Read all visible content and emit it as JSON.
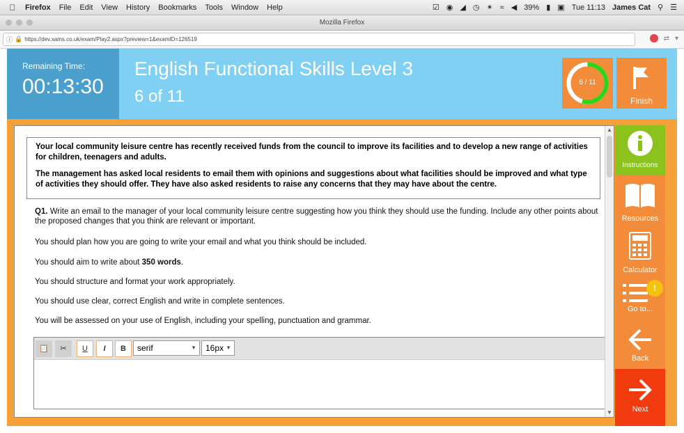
{
  "menubar": {
    "items": [
      "Firefox",
      "File",
      "Edit",
      "View",
      "History",
      "Bookmarks",
      "Tools",
      "Window",
      "Help"
    ],
    "battery": "39%",
    "clock": "Tue 11:13",
    "user": "James Cat"
  },
  "window": {
    "title": "Mozilla Firefox"
  },
  "browser": {
    "url": "https://dev.xams.co.uk/exam/Play2.aspx?preview=1&examID=126519"
  },
  "exam": {
    "remaining_label": "Remaining Time:",
    "remaining_time": "00:13:30",
    "title": "English Functional Skills Level 3",
    "position": "6 of 11",
    "progress_label": "6 / 11",
    "progress_fraction": 0.545,
    "finish_label": "Finish"
  },
  "notice": {
    "para1": "Your local community leisure centre has recently received funds from the council to improve its facilities and to develop a new range of activities for children, teenagers and adults.",
    "para2": "The management has asked local residents to email them with opinions and suggestions about what facilities should be improved and what type of activities they should offer. They have also asked residents to raise any concerns that they may have about the centre."
  },
  "question": {
    "q_label": "Q1.",
    "q_text": " Write an email to the manager of your local community leisure centre suggesting how you think they should use the funding. Include any other points about the proposed changes that you think are relevant or important.",
    "p2": "You should plan how you are going to write your email and what you think should be included.",
    "p3_pre": "You should aim to write about ",
    "p3_bold": "350 words",
    "p3_post": ".",
    "p4": "You should structure and format your work appropriately.",
    "p5": "You should use clear, correct English and write in complete sentences.",
    "p6": "You will be assessed on your use of English, including your spelling, punctuation and grammar."
  },
  "editor": {
    "font_family": "serif",
    "font_size": "16px",
    "underline_label": "U",
    "italic_label": "I",
    "bold_label": "B"
  },
  "sidebar": {
    "instructions": "Instructions",
    "resources": "Resources",
    "calculator": "Calculator",
    "goto": "Go to...",
    "goto_badge": "!",
    "back": "Back",
    "next": "Next"
  },
  "colors": {
    "header_blue": "#7fd0f3",
    "timer_blue": "#4a9fcd",
    "orange": "#f28c3a",
    "green": "#8cc21c",
    "red": "#f23a0f"
  }
}
